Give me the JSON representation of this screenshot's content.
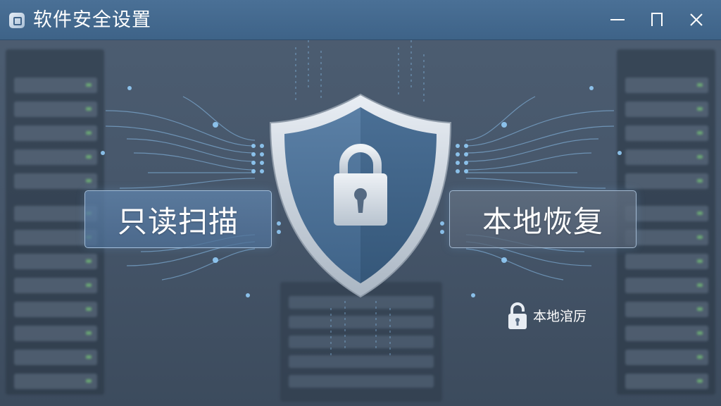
{
  "window": {
    "title": "软件安全设置",
    "controls": {
      "minimize_icon": "minimize-icon",
      "maximize_icon": "maximize-icon",
      "close_icon": "close-icon"
    }
  },
  "main": {
    "actions": [
      {
        "label": "只读扫描"
      },
      {
        "label": "本地恢复"
      }
    ],
    "center_icon": "shield-lock-icon",
    "local_restore_hint": {
      "icon": "lock-icon",
      "label": "本地涫厉"
    }
  },
  "colors": {
    "titlebar": "#446a90",
    "background": "#46566a",
    "accent": "#7fc8ff",
    "shield_inner": "#4f7296"
  }
}
